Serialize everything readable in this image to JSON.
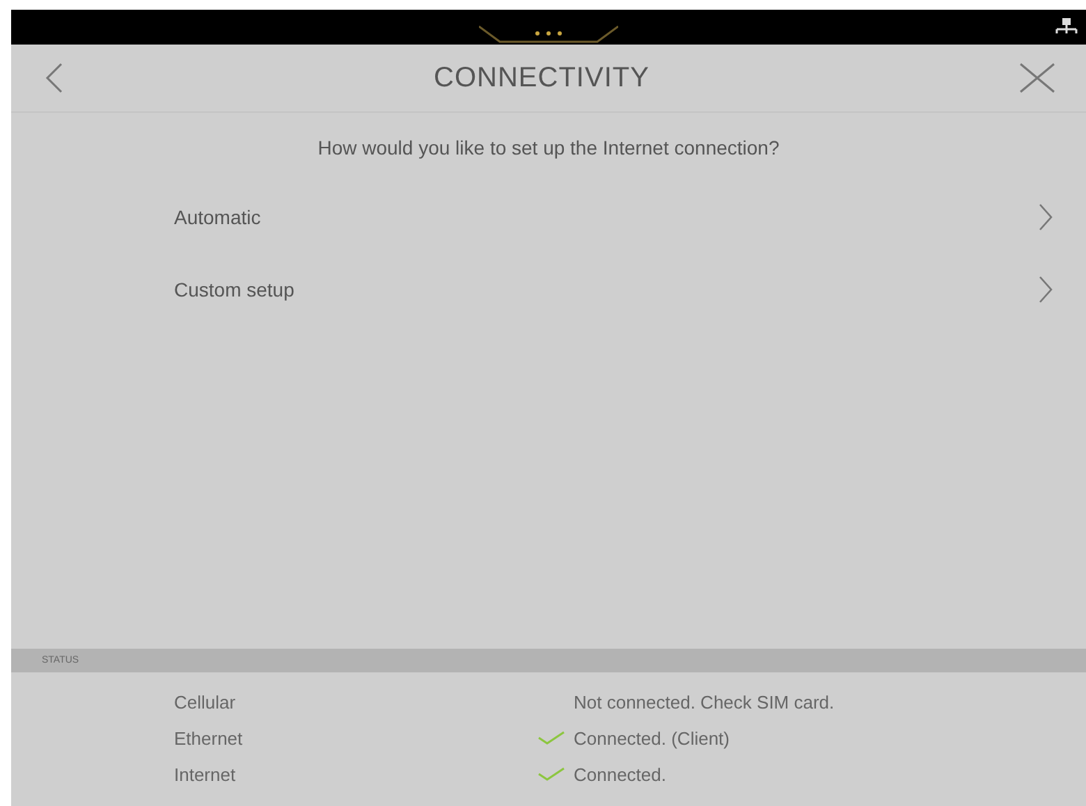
{
  "header": {
    "title": "CONNECTIVITY"
  },
  "question": "How would you like to set up the Internet connection?",
  "options": [
    {
      "label": "Automatic"
    },
    {
      "label": "Custom setup"
    }
  ],
  "status": {
    "heading": "STATUS",
    "rows": [
      {
        "name": "Cellular",
        "connected": false,
        "text": "Not connected. Check SIM card."
      },
      {
        "name": "Ethernet",
        "connected": true,
        "text": "Connected. (Client)"
      },
      {
        "name": "Internet",
        "connected": true,
        "text": "Connected."
      }
    ]
  }
}
